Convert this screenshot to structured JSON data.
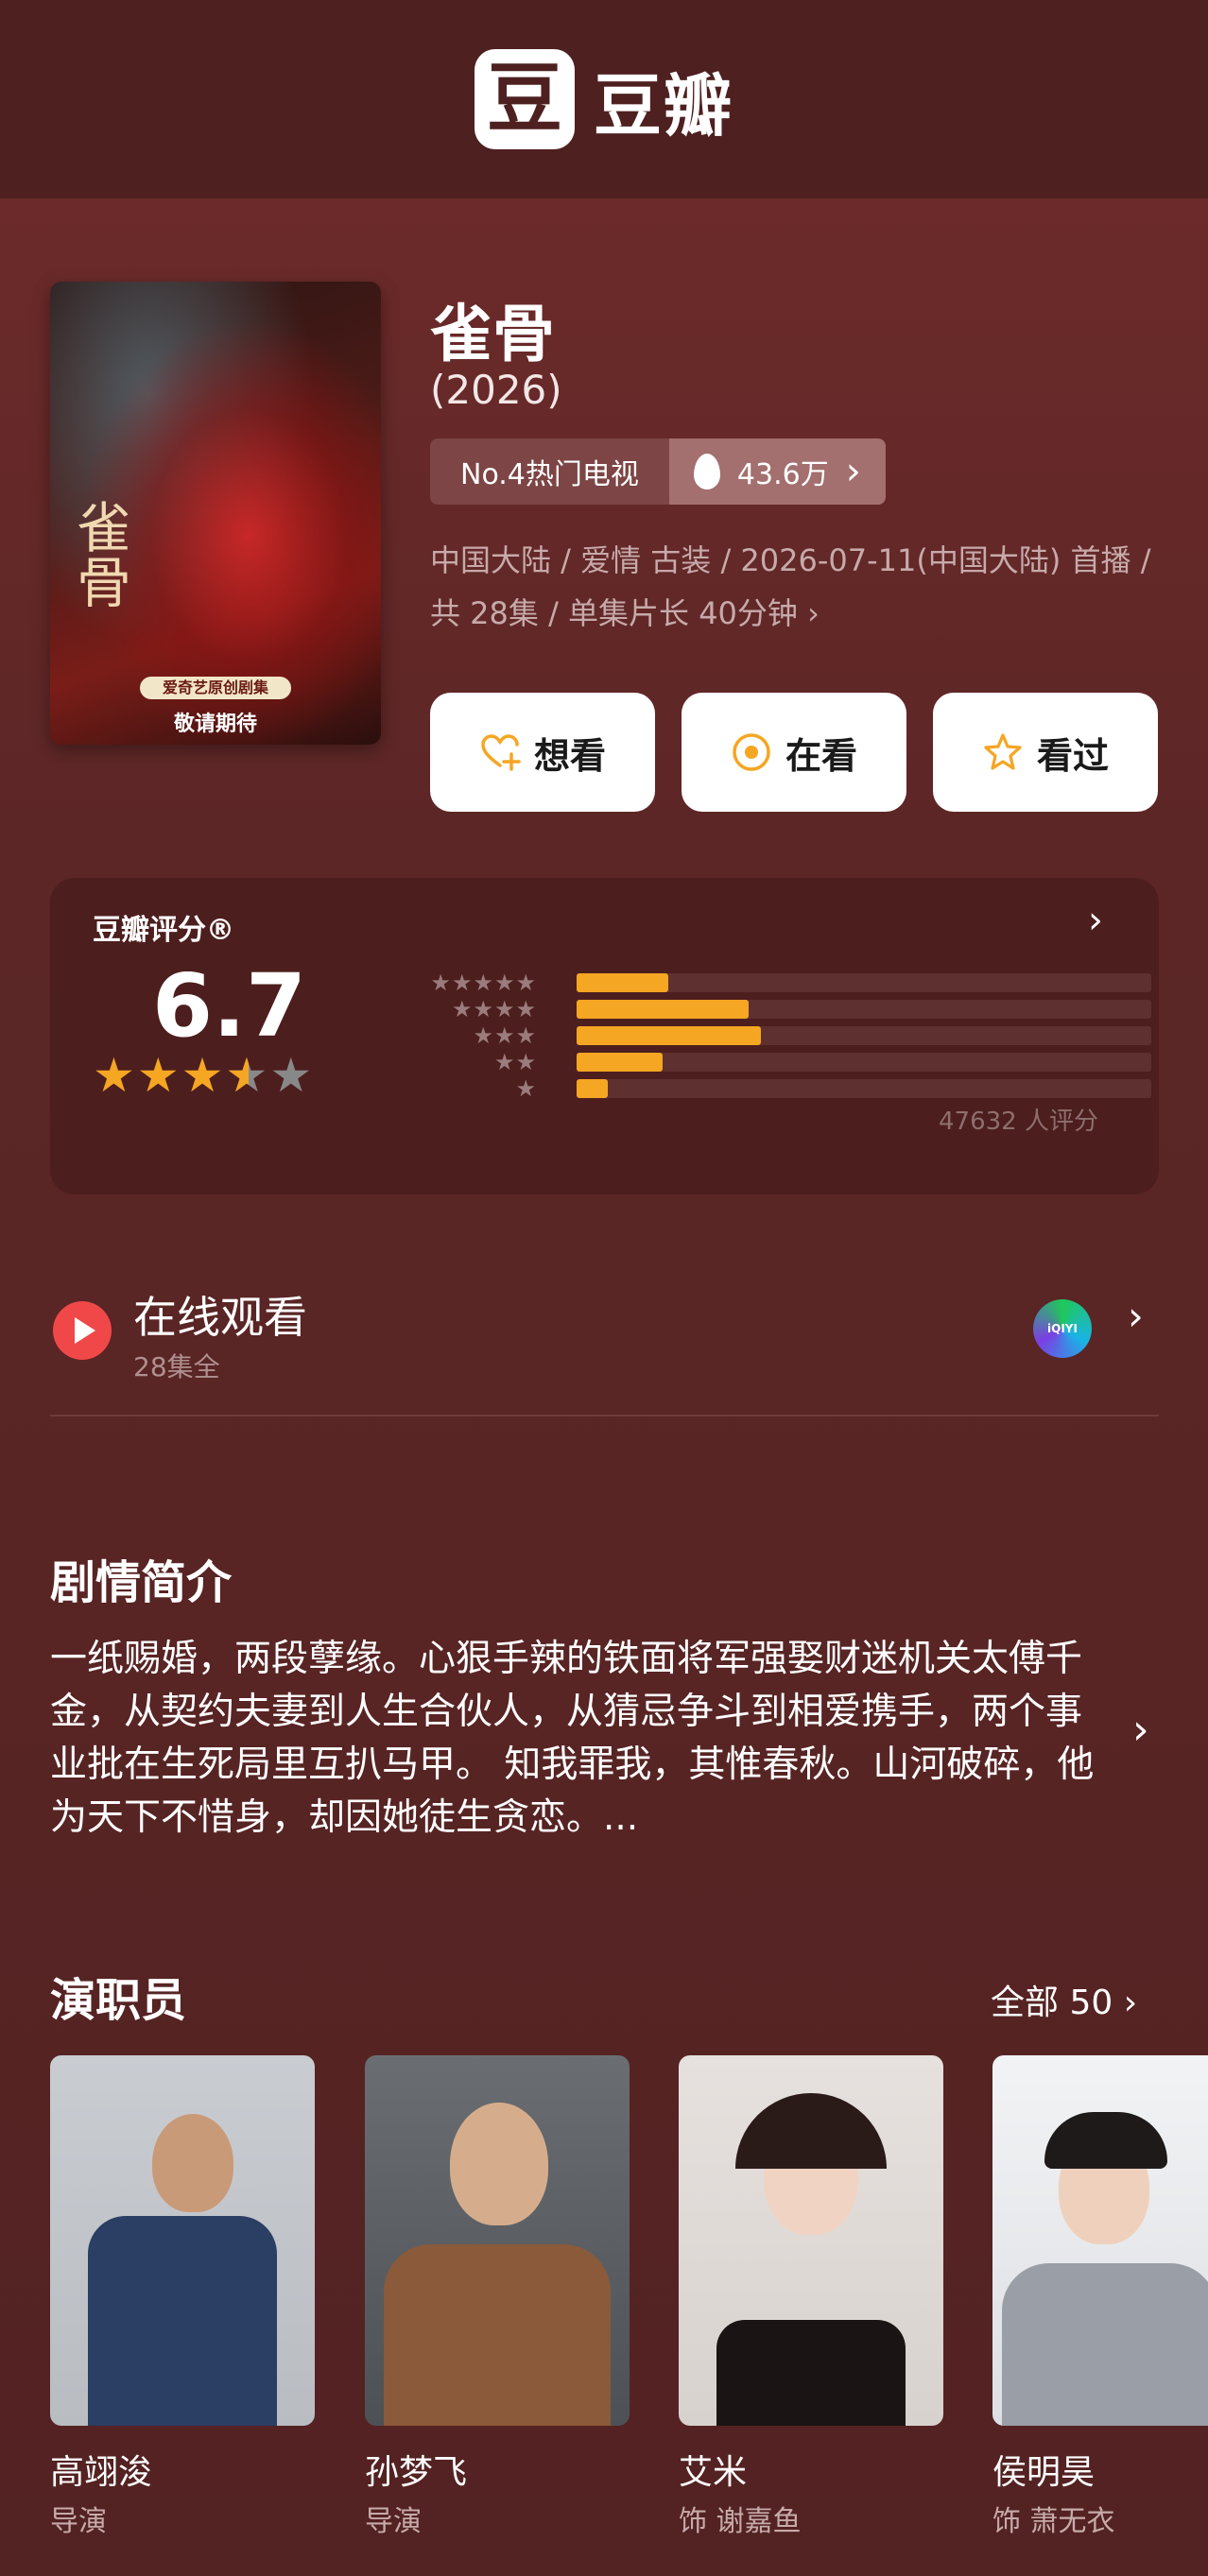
{
  "app": {
    "logo_glyph": "豆",
    "logo_text": "豆瓣"
  },
  "poster": {
    "title": "雀骨",
    "badge": "爱奇艺原创剧集",
    "coming": "敬请期待"
  },
  "show": {
    "title": "雀骨",
    "year": "(2026)",
    "rank": "No.4热门电视",
    "heat": "43.6万",
    "meta_line1": "中国大陆 / 爱情 古装 / 2026-07-11(中国大陆) 首播 /",
    "meta_line2": "共 28集 / 单集片长 40分钟 ›"
  },
  "actions": [
    {
      "label": "想看",
      "icon": "heart-plus-icon"
    },
    {
      "label": "在看",
      "icon": "target-circle-icon"
    },
    {
      "label": "看过",
      "icon": "star-outline-icon"
    }
  ],
  "rating": {
    "label": "豆瓣评分®",
    "score": "6.7",
    "stars_value": 3.5,
    "distribution": [
      {
        "stars": "★★★★★",
        "fraction": 0.16
      },
      {
        "stars": "★★★★",
        "fraction": 0.3
      },
      {
        "stars": "★★★",
        "fraction": 0.32
      },
      {
        "stars": "★★",
        "fraction": 0.15
      },
      {
        "stars": "★",
        "fraction": 0.055
      }
    ],
    "count": "47632 人评分"
  },
  "watch": {
    "title": "在线观看",
    "subtitle": "28集全",
    "provider": "iQIYI 爱奇艺"
  },
  "synopsis": {
    "title": "剧情简介",
    "text": "一纸赐婚，两段孽缘。心狠手辣的铁面将军强娶财迷机关太傅千金，从契约夫妻到人生合伙人，从猜忌争斗到相爱携手，两个事业批在生死局里互扒马甲。 知我罪我，其惟春秋。山河破碎，他为天下不惜身，却因她徒生贪恋。..."
  },
  "cast": {
    "title": "演职员",
    "all_label": "全部 50",
    "members": [
      {
        "name": "高翊浚",
        "role": "导演"
      },
      {
        "name": "孙梦飞",
        "role": "导演"
      },
      {
        "name": "艾米",
        "role": "饰 谢嘉鱼"
      },
      {
        "name": "侯明昊",
        "role": "饰 萧无衣"
      }
    ]
  },
  "colors": {
    "accent": "#f5a623",
    "background": "#5a2525",
    "header": "#4e2020"
  }
}
